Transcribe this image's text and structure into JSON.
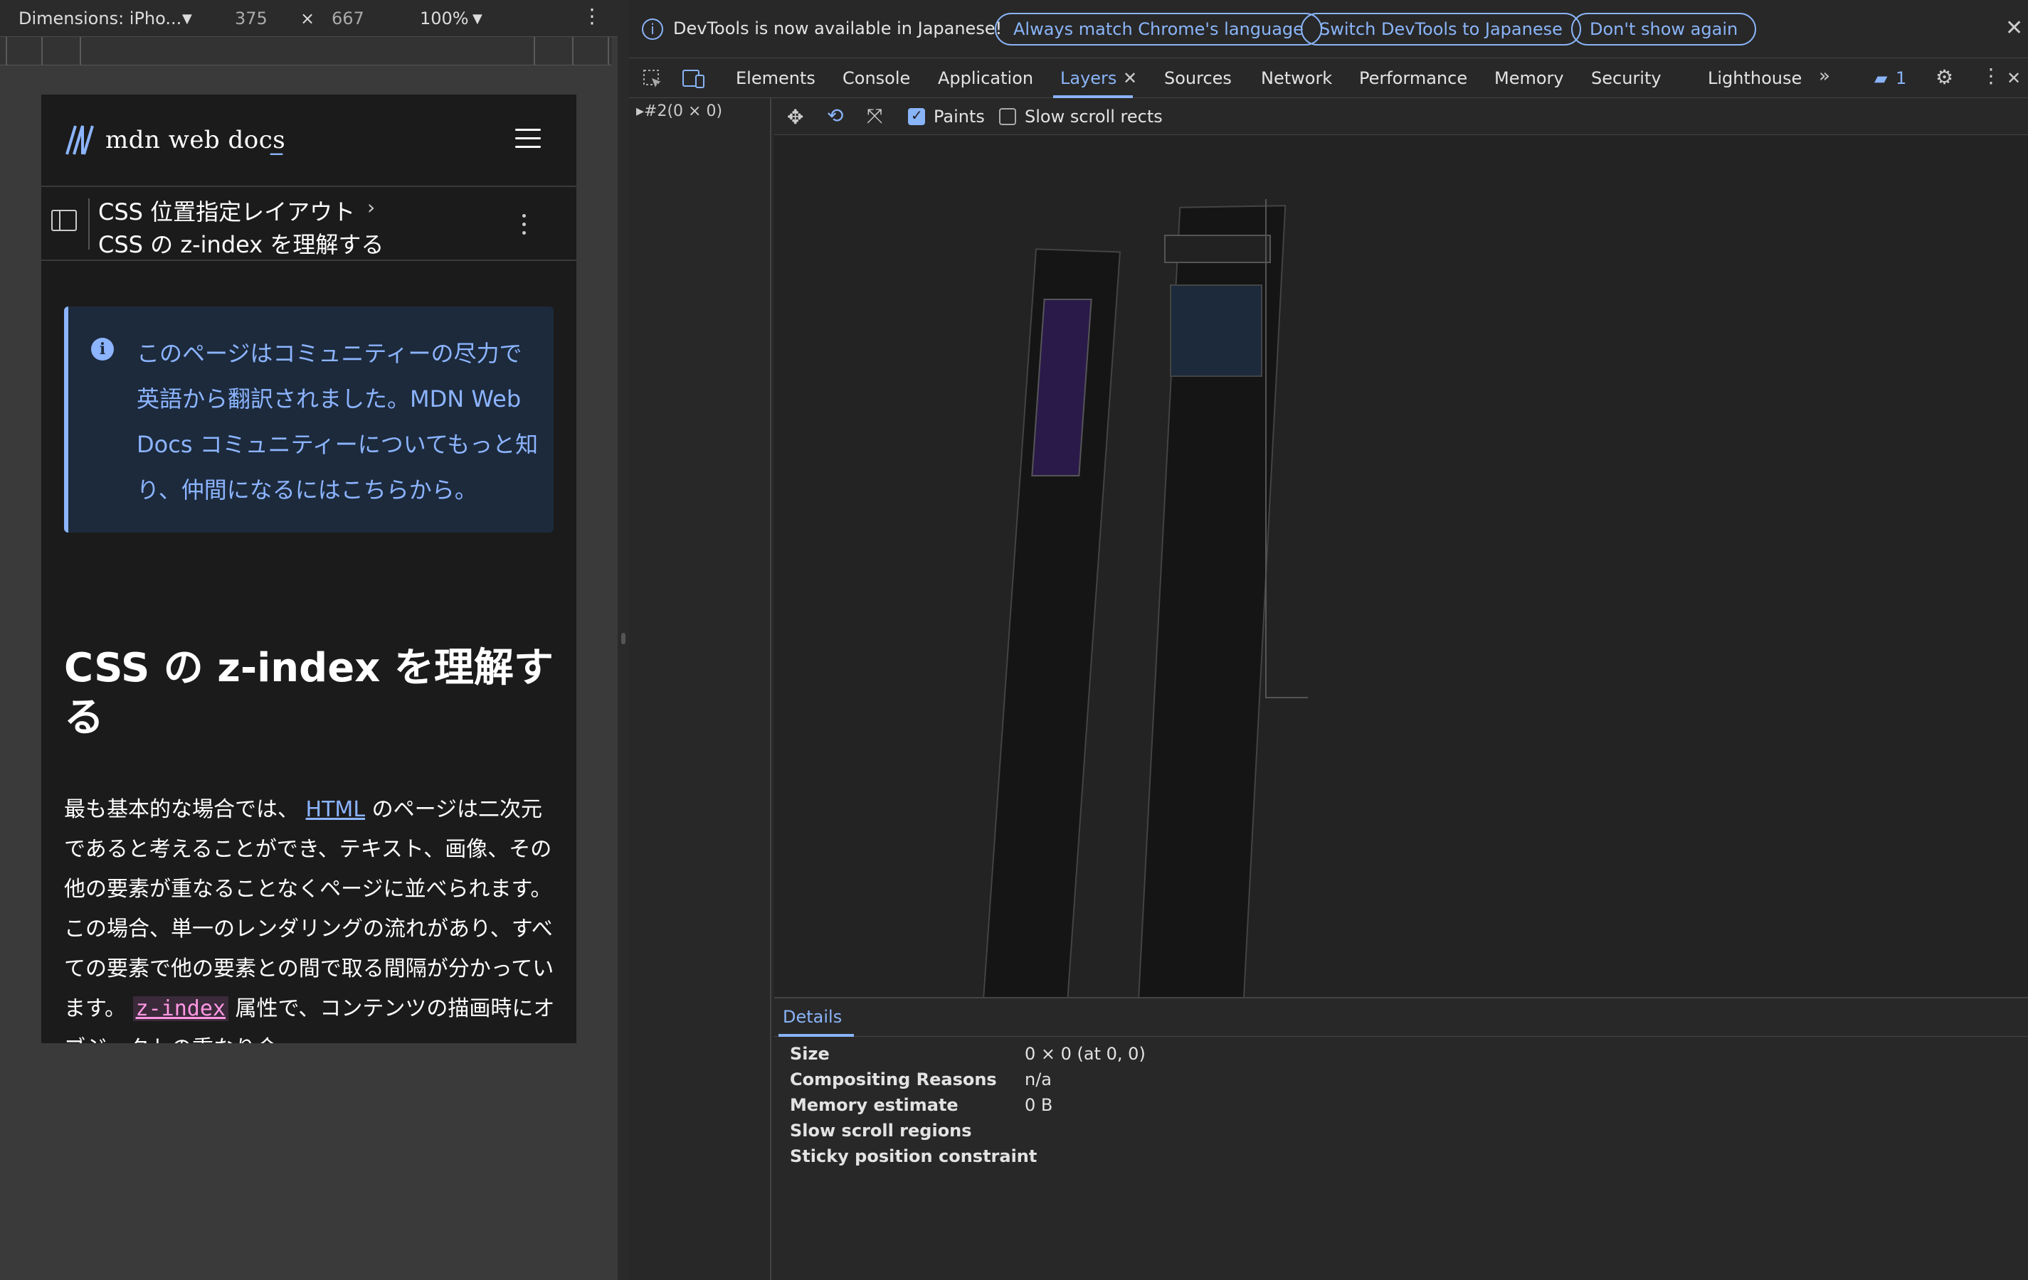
{
  "device_toolbar": {
    "dimensions_label": "Dimensions: iPho...",
    "width": "375",
    "times": "×",
    "height": "667",
    "zoom": "100%"
  },
  "mdn": {
    "logo_text": "mdn web docs",
    "logo_suffix": "_",
    "breadcrumb_parent": "CSS 位置指定レイアウト",
    "breadcrumb_current": "CSS の z-index を理解する",
    "notice_text": "このページはコミュニティーの尽力で英語から翻訳されました。MDN Web Docs コミュニティーについてもっと知り、仲間になるにはこちらから。",
    "title": "CSS の z-index を理解する",
    "body_before_link": "最も基本的な場合では、",
    "body_link": "HTML",
    "body_after_link": " のページは二次元であると考えることができ、テキスト、画像、その他の要素が重なることなくページに並べられます。この場合、単一のレンダリングの流れがあり、すべての要素で他の要素との間で取る間隔が分かっています。",
    "body_code": "z-index",
    "body_after_code": " 属性で、コンテンツの描画時にオブジェクトの重なり合"
  },
  "devtools": {
    "infobar": {
      "message": "DevTools is now available in Japanese!",
      "btn_match": "Always match Chrome's language",
      "btn_switch": "Switch DevTools to Japanese",
      "btn_dismiss": "Don't show again"
    },
    "tabs": [
      "Elements",
      "Console",
      "Application",
      "Layers",
      "Sources",
      "Network",
      "Performance",
      "Memory",
      "Security",
      "Lighthouse"
    ],
    "issues_count": "1",
    "layer_tree_node": "#2(0 × 0)",
    "toolbar": {
      "paints_label": "Paints",
      "slow_scroll_label": "Slow scroll rects"
    },
    "details": {
      "tab": "Details",
      "rows": [
        {
          "key": "Size",
          "value": "0 × 0 (at 0, 0)"
        },
        {
          "key": "Compositing Reasons",
          "value": "n/a"
        },
        {
          "key": "Memory estimate",
          "value": "0 B"
        },
        {
          "key": "Slow scroll regions",
          "value": ""
        },
        {
          "key": "Sticky position constraint",
          "value": ""
        }
      ]
    },
    "colors": {
      "accent": "#8ab4f8",
      "bg": "#282828"
    }
  }
}
